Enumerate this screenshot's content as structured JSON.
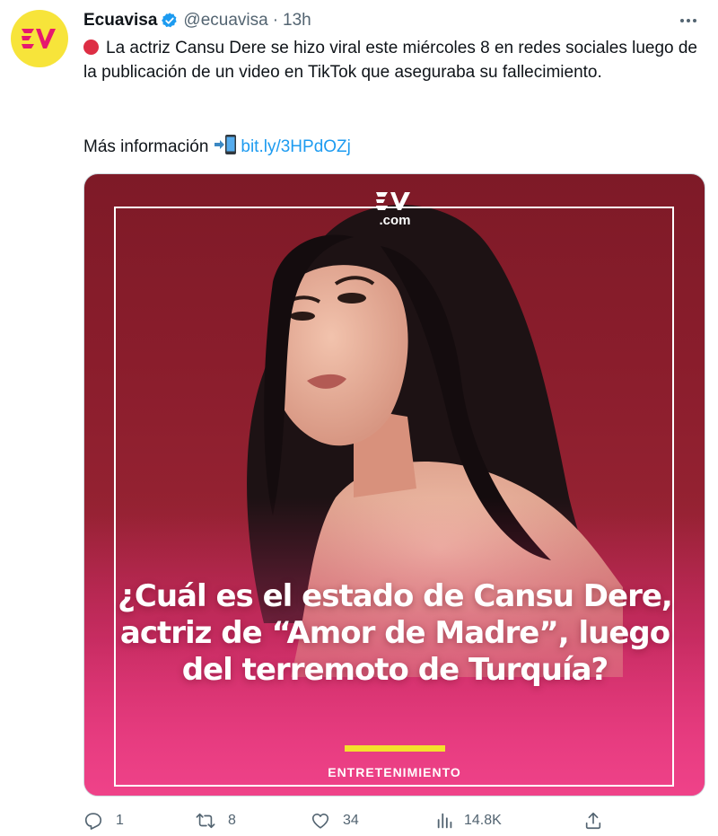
{
  "account": {
    "name": "Ecuavisa",
    "handle": "@ecuavisa",
    "separator": "·",
    "time": "13h"
  },
  "tweet": {
    "text": "La actriz Cansu Dere se hizo viral este miércoles 8 en redes sociales luego de la publicación de un video en TikTok que aseguraba su fallecimiento.",
    "more_info_label": "Más información",
    "link": "bit.ly/3HPdOZj"
  },
  "media": {
    "logo_suffix": ".com",
    "headline": "¿Cuál es el estado de Cansu Dere, actriz de “Amor de Madre”, luego del terremoto de Turquía?",
    "category": "ENTRETENIMIENTO",
    "accent_color": "#f4e12c"
  },
  "actions": {
    "replies": "1",
    "retweets": "8",
    "likes": "34",
    "views": "14.8K"
  },
  "colors": {
    "brand_avatar": "#f7e43a",
    "brand_logo": "#e6196e",
    "link": "#1d9bf0",
    "secondary_text": "#536471"
  },
  "icons": [
    "ecuavisa-logo",
    "verified-badge-icon",
    "more-icon",
    "red-circle-emoji",
    "mobile-arrow-emoji",
    "reply-icon",
    "retweet-icon",
    "like-icon",
    "views-icon",
    "share-icon"
  ]
}
